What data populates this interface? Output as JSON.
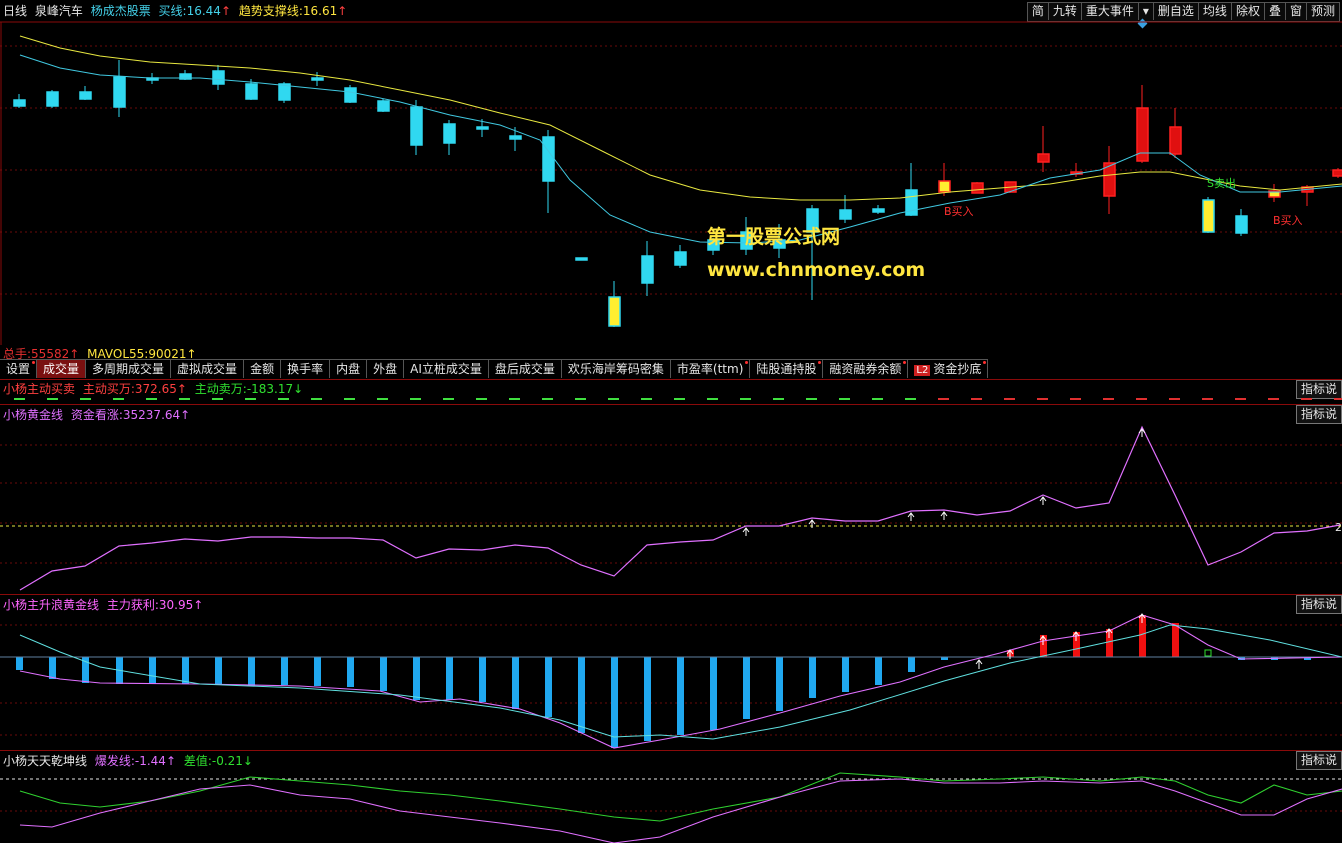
{
  "main_header": {
    "period": "日线",
    "stock_name": "泉峰汽车",
    "indicator_name": "杨成杰股票",
    "buy_line_label": "买线:",
    "buy_line_value": "16.44",
    "buy_line_arrow": "↑",
    "trend_label": "趋势支撑线:",
    "trend_value": "16.61",
    "trend_arrow": "↑"
  },
  "toolbar": [
    "简",
    "九转",
    "重大事件",
    "▾",
    "删自选",
    "均线",
    "除权",
    "叠",
    "窗",
    "预测"
  ],
  "watermark": {
    "site_name": "第一股票公式网",
    "url": "www.chnmoney.com"
  },
  "chart_signals": {
    "b_buy_1": "B买入",
    "b_buy_2": "B买入",
    "s_sell": "S卖出"
  },
  "volume_header": {
    "total_label": "总手:",
    "total_value": "55582↑",
    "mavol_label": "MAVOL55:",
    "mavol_value": "90021↑"
  },
  "tabs": [
    {
      "label": "设置",
      "dot": true
    },
    {
      "label": "成交量",
      "active": true
    },
    {
      "label": "多周期成交量"
    },
    {
      "label": "虚拟成交量"
    },
    {
      "label": "金额"
    },
    {
      "label": "换手率"
    },
    {
      "label": "内盘"
    },
    {
      "label": "外盘"
    },
    {
      "label": "AI立桩成交量"
    },
    {
      "label": "盘后成交量"
    },
    {
      "label": "欢乐海岸筹码密集"
    },
    {
      "label": "市盈率(ttm)",
      "dot": true
    },
    {
      "label": "陆股通持股",
      "dot": true
    },
    {
      "label": "融资融券余额",
      "dot": true
    },
    {
      "label": "资金抄底",
      "badge": "L2",
      "dot": true
    }
  ],
  "panel1": {
    "title": "小杨主动买卖",
    "buy_label": "主动买万:",
    "buy_value": "372.65↑",
    "sell_label": "主动卖万:",
    "sell_value": "-183.17↓",
    "button": "指标说"
  },
  "panel2": {
    "title": "小杨黄金线",
    "label": "资金看涨:",
    "value": "35237.64↑",
    "button": "指标说",
    "right_value": "2"
  },
  "panel3": {
    "title": "小杨主升浪黄金线",
    "label": "主力获利:",
    "value": "30.95↑",
    "button": "指标说"
  },
  "panel4": {
    "title": "小杨天天乾坤线",
    "burst_label": "爆发线:",
    "burst_value": "-1.44↑",
    "diff_label": "差值:",
    "diff_value": "-0.21↓",
    "button": "指标说"
  },
  "colors": {
    "up_candle": "#ff2020",
    "down_candle": "#30d8f0",
    "ma_yellow": "#e8e840",
    "ma_cyan": "#40c8e0",
    "grid": "#8a0a0a",
    "magenta_line": "#e070ff",
    "green_line": "#30d030"
  }
}
